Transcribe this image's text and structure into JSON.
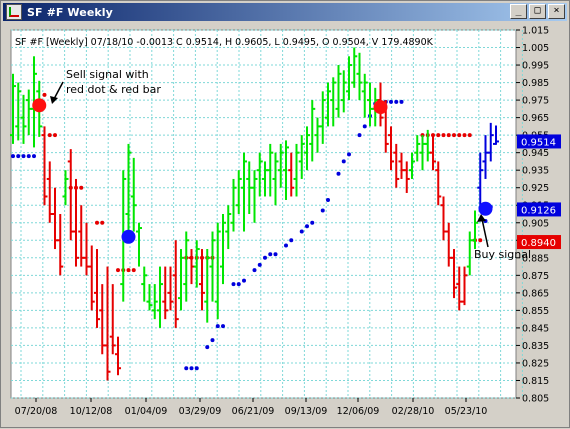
{
  "window": {
    "title": "SF #F Weekly",
    "buttons": {
      "minimize": "_",
      "maximize": "□",
      "close": "×"
    }
  },
  "info_line": "SF #F [Weekly] 07/18/10 -0.0013 C 0.9514, H 0.9605, L 0.9495, O 0.9504, V 179.4890K",
  "annotations": {
    "sell": [
      "Sell signal with",
      "red dot & red bar"
    ],
    "buy": "Buy signal"
  },
  "colors": {
    "up": "#00e600",
    "down": "#e60000",
    "stop_blue": "#0000dd",
    "stop_red": "#e60000",
    "grid": "#7fd8d8",
    "plot_bg": "#ffffff"
  },
  "chart_data": {
    "type": "bar",
    "subtype": "ohlc-weekly",
    "y_range": [
      0.805,
      1.015
    ],
    "yticks": [
      "1.015",
      "1.005",
      "0.995",
      "0.985",
      "0.975",
      "0.965",
      "0.955",
      "0.945",
      "0.935",
      "0.925",
      "0.915",
      "0.905",
      "0.895",
      "0.885",
      "0.875",
      "0.865",
      "0.855",
      "0.845",
      "0.835",
      "0.825",
      "0.815",
      "0.805"
    ],
    "xticks": [
      "07/20/08",
      "10/12/08",
      "01/04/09",
      "03/29/09",
      "06/21/09",
      "09/13/09",
      "12/06/09",
      "02/28/10",
      "05/23/10"
    ],
    "price_labels": [
      {
        "text": "0.9514",
        "value": 0.9514,
        "color": "#0000dd"
      },
      {
        "text": "0.9126",
        "value": 0.9126,
        "color": "#0000dd"
      },
      {
        "text": "0.8940",
        "value": 0.894,
        "color": "#e60000"
      }
    ],
    "bars": [
      {
        "o": 0.955,
        "h": 0.99,
        "l": 0.95,
        "c": 0.983,
        "col": "up"
      },
      {
        "o": 0.96,
        "h": 0.985,
        "l": 0.952,
        "c": 0.98,
        "col": "up"
      },
      {
        "o": 0.965,
        "h": 0.978,
        "l": 0.95,
        "c": 0.96,
        "col": "up"
      },
      {
        "o": 0.975,
        "h": 0.981,
        "l": 0.955,
        "c": 0.97,
        "col": "up"
      },
      {
        "o": 0.97,
        "h": 1.0,
        "l": 0.948,
        "c": 0.99,
        "col": "up"
      },
      {
        "o": 0.98,
        "h": 0.986,
        "l": 0.954,
        "c": 0.96,
        "col": "up"
      },
      {
        "o": 0.955,
        "h": 0.96,
        "l": 0.915,
        "c": 0.92,
        "col": "down"
      },
      {
        "o": 0.93,
        "h": 0.94,
        "l": 0.905,
        "c": 0.91,
        "col": "down"
      },
      {
        "o": 0.91,
        "h": 0.925,
        "l": 0.89,
        "c": 0.895,
        "col": "down"
      },
      {
        "o": 0.895,
        "h": 0.91,
        "l": 0.875,
        "c": 0.88,
        "col": "down"
      },
      {
        "o": 0.92,
        "h": 0.935,
        "l": 0.915,
        "c": 0.93,
        "col": "up"
      },
      {
        "o": 0.94,
        "h": 0.947,
        "l": 0.895,
        "c": 0.9,
        "col": "down"
      },
      {
        "o": 0.9,
        "h": 0.93,
        "l": 0.88,
        "c": 0.885,
        "col": "down"
      },
      {
        "o": 0.9,
        "h": 0.915,
        "l": 0.88,
        "c": 0.885,
        "col": "down"
      },
      {
        "o": 0.885,
        "h": 0.905,
        "l": 0.875,
        "c": 0.88,
        "col": "down"
      },
      {
        "o": 0.88,
        "h": 0.892,
        "l": 0.855,
        "c": 0.86,
        "col": "down"
      },
      {
        "o": 0.865,
        "h": 0.89,
        "l": 0.845,
        "c": 0.85,
        "col": "down"
      },
      {
        "o": 0.855,
        "h": 0.87,
        "l": 0.83,
        "c": 0.835,
        "col": "down"
      },
      {
        "o": 0.835,
        "h": 0.88,
        "l": 0.815,
        "c": 0.82,
        "col": "down"
      },
      {
        "o": 0.84,
        "h": 0.87,
        "l": 0.83,
        "c": 0.835,
        "col": "down"
      },
      {
        "o": 0.83,
        "h": 0.84,
        "l": 0.818,
        "c": 0.822,
        "col": "down"
      },
      {
        "o": 0.87,
        "h": 0.935,
        "l": 0.86,
        "c": 0.93,
        "col": "up"
      },
      {
        "o": 0.91,
        "h": 0.95,
        "l": 0.9,
        "c": 0.945,
        "col": "up"
      },
      {
        "o": 0.92,
        "h": 0.942,
        "l": 0.9,
        "c": 0.915,
        "col": "up"
      },
      {
        "o": 0.9,
        "h": 0.905,
        "l": 0.88,
        "c": 0.902,
        "col": "up"
      },
      {
        "o": 0.87,
        "h": 0.88,
        "l": 0.86,
        "c": 0.875,
        "col": "up"
      },
      {
        "o": 0.86,
        "h": 0.87,
        "l": 0.855,
        "c": 0.858,
        "col": "up"
      },
      {
        "o": 0.855,
        "h": 0.87,
        "l": 0.85,
        "c": 0.86,
        "col": "up"
      },
      {
        "o": 0.855,
        "h": 0.88,
        "l": 0.845,
        "c": 0.87,
        "col": "up"
      },
      {
        "o": 0.86,
        "h": 0.88,
        "l": 0.85,
        "c": 0.855,
        "col": "down"
      },
      {
        "o": 0.865,
        "h": 0.88,
        "l": 0.855,
        "c": 0.86,
        "col": "down"
      },
      {
        "o": 0.875,
        "h": 0.895,
        "l": 0.845,
        "c": 0.85,
        "col": "down"
      },
      {
        "o": 0.862,
        "h": 0.89,
        "l": 0.855,
        "c": 0.885,
        "col": "up"
      },
      {
        "o": 0.87,
        "h": 0.9,
        "l": 0.86,
        "c": 0.895,
        "col": "up"
      },
      {
        "o": 0.885,
        "h": 0.89,
        "l": 0.87,
        "c": 0.88,
        "col": "down"
      },
      {
        "o": 0.88,
        "h": 0.895,
        "l": 0.868,
        "c": 0.89,
        "col": "up"
      },
      {
        "o": 0.87,
        "h": 0.89,
        "l": 0.855,
        "c": 0.865,
        "col": "down"
      },
      {
        "o": 0.86,
        "h": 0.89,
        "l": 0.848,
        "c": 0.885,
        "col": "up"
      },
      {
        "o": 0.88,
        "h": 0.9,
        "l": 0.86,
        "c": 0.895,
        "col": "up"
      },
      {
        "o": 0.86,
        "h": 0.905,
        "l": 0.85,
        "c": 0.9,
        "col": "up"
      },
      {
        "o": 0.88,
        "h": 0.91,
        "l": 0.87,
        "c": 0.905,
        "col": "up"
      },
      {
        "o": 0.9,
        "h": 0.915,
        "l": 0.89,
        "c": 0.91,
        "col": "up"
      },
      {
        "o": 0.905,
        "h": 0.93,
        "l": 0.9,
        "c": 0.925,
        "col": "up"
      },
      {
        "o": 0.915,
        "h": 0.935,
        "l": 0.91,
        "c": 0.93,
        "col": "up"
      },
      {
        "o": 0.925,
        "h": 0.945,
        "l": 0.9,
        "c": 0.94,
        "col": "up"
      },
      {
        "o": 0.93,
        "h": 0.94,
        "l": 0.91,
        "c": 0.925,
        "col": "up"
      },
      {
        "o": 0.925,
        "h": 0.935,
        "l": 0.905,
        "c": 0.93,
        "col": "up"
      },
      {
        "o": 0.935,
        "h": 0.945,
        "l": 0.92,
        "c": 0.94,
        "col": "up"
      },
      {
        "o": 0.93,
        "h": 0.94,
        "l": 0.92,
        "c": 0.935,
        "col": "up"
      },
      {
        "o": 0.935,
        "h": 0.95,
        "l": 0.92,
        "c": 0.945,
        "col": "up"
      },
      {
        "o": 0.93,
        "h": 0.945,
        "l": 0.915,
        "c": 0.94,
        "col": "up"
      },
      {
        "o": 0.935,
        "h": 0.95,
        "l": 0.925,
        "c": 0.945,
        "col": "up"
      },
      {
        "o": 0.935,
        "h": 0.952,
        "l": 0.918,
        "c": 0.948,
        "col": "up"
      },
      {
        "o": 0.935,
        "h": 0.945,
        "l": 0.92,
        "c": 0.925,
        "col": "down"
      },
      {
        "o": 0.93,
        "h": 0.95,
        "l": 0.92,
        "c": 0.945,
        "col": "up"
      },
      {
        "o": 0.94,
        "h": 0.955,
        "l": 0.93,
        "c": 0.95,
        "col": "up"
      },
      {
        "o": 0.945,
        "h": 0.96,
        "l": 0.935,
        "c": 0.955,
        "col": "up"
      },
      {
        "o": 0.95,
        "h": 0.975,
        "l": 0.94,
        "c": 0.97,
        "col": "up"
      },
      {
        "o": 0.955,
        "h": 0.965,
        "l": 0.945,
        "c": 0.96,
        "col": "up"
      },
      {
        "o": 0.96,
        "h": 0.98,
        "l": 0.95,
        "c": 0.975,
        "col": "up"
      },
      {
        "o": 0.965,
        "h": 0.985,
        "l": 0.96,
        "c": 0.98,
        "col": "up"
      },
      {
        "o": 0.975,
        "h": 0.988,
        "l": 0.96,
        "c": 0.985,
        "col": "up"
      },
      {
        "o": 0.97,
        "h": 0.995,
        "l": 0.965,
        "c": 0.99,
        "col": "up"
      },
      {
        "o": 0.975,
        "h": 0.992,
        "l": 0.968,
        "c": 0.985,
        "col": "up"
      },
      {
        "o": 0.98,
        "h": 1.0,
        "l": 0.975,
        "c": 0.995,
        "col": "up"
      },
      {
        "o": 0.985,
        "h": 1.005,
        "l": 0.982,
        "c": 1.0,
        "col": "up"
      },
      {
        "o": 0.99,
        "h": 1.002,
        "l": 0.975,
        "c": 0.985,
        "col": "up"
      },
      {
        "o": 0.98,
        "h": 0.99,
        "l": 0.965,
        "c": 0.985,
        "col": "up"
      },
      {
        "o": 0.975,
        "h": 0.985,
        "l": 0.96,
        "c": 0.97,
        "col": "up"
      },
      {
        "o": 0.97,
        "h": 0.982,
        "l": 0.96,
        "c": 0.975,
        "col": "up"
      },
      {
        "o": 0.975,
        "h": 0.985,
        "l": 0.96,
        "c": 0.965,
        "col": "down"
      },
      {
        "o": 0.97,
        "h": 0.975,
        "l": 0.945,
        "c": 0.95,
        "col": "down"
      },
      {
        "o": 0.955,
        "h": 0.96,
        "l": 0.935,
        "c": 0.94,
        "col": "down"
      },
      {
        "o": 0.945,
        "h": 0.95,
        "l": 0.925,
        "c": 0.93,
        "col": "down"
      },
      {
        "o": 0.94,
        "h": 0.945,
        "l": 0.93,
        "c": 0.935,
        "col": "down"
      },
      {
        "o": 0.935,
        "h": 0.94,
        "l": 0.922,
        "c": 0.93,
        "col": "down"
      },
      {
        "o": 0.935,
        "h": 0.945,
        "l": 0.93,
        "c": 0.94,
        "col": "up"
      },
      {
        "o": 0.945,
        "h": 0.955,
        "l": 0.94,
        "c": 0.95,
        "col": "up"
      },
      {
        "o": 0.945,
        "h": 0.955,
        "l": 0.935,
        "c": 0.95,
        "col": "up"
      },
      {
        "o": 0.95,
        "h": 0.958,
        "l": 0.94,
        "c": 0.945,
        "col": "up"
      },
      {
        "o": 0.945,
        "h": 0.955,
        "l": 0.935,
        "c": 0.94,
        "col": "down"
      },
      {
        "o": 0.935,
        "h": 0.94,
        "l": 0.915,
        "c": 0.92,
        "col": "down"
      },
      {
        "o": 0.915,
        "h": 0.92,
        "l": 0.895,
        "c": 0.9,
        "col": "down"
      },
      {
        "o": 0.9,
        "h": 0.905,
        "l": 0.88,
        "c": 0.885,
        "col": "down"
      },
      {
        "o": 0.885,
        "h": 0.89,
        "l": 0.862,
        "c": 0.868,
        "col": "down"
      },
      {
        "o": 0.87,
        "h": 0.88,
        "l": 0.855,
        "c": 0.86,
        "col": "down"
      },
      {
        "o": 0.86,
        "h": 0.88,
        "l": 0.858,
        "c": 0.875,
        "col": "down"
      },
      {
        "o": 0.88,
        "h": 0.9,
        "l": 0.875,
        "c": 0.895,
        "col": "up"
      },
      {
        "o": 0.895,
        "h": 0.912,
        "l": 0.89,
        "c": 0.905,
        "col": "up"
      },
      {
        "o": 0.925,
        "h": 0.945,
        "l": 0.915,
        "c": 0.935,
        "col": "stop_blue"
      },
      {
        "o": 0.94,
        "h": 0.955,
        "l": 0.93,
        "c": 0.945,
        "col": "stop_blue"
      },
      {
        "o": 0.945,
        "h": 0.962,
        "l": 0.94,
        "c": 0.955,
        "col": "stop_blue"
      },
      {
        "o": 0.95,
        "h": 0.9605,
        "l": 0.9495,
        "c": 0.9514,
        "col": "stop_blue"
      }
    ],
    "blue_stops": [
      {
        "i": 0,
        "v": 0.943
      },
      {
        "i": 1,
        "v": 0.943
      },
      {
        "i": 2,
        "v": 0.943
      },
      {
        "i": 3,
        "v": 0.943
      },
      {
        "i": 4,
        "v": 0.943
      },
      {
        "i": 33,
        "v": 0.822
      },
      {
        "i": 34,
        "v": 0.822
      },
      {
        "i": 35,
        "v": 0.822
      },
      {
        "i": 37,
        "v": 0.834
      },
      {
        "i": 38,
        "v": 0.838
      },
      {
        "i": 39,
        "v": 0.846
      },
      {
        "i": 40,
        "v": 0.846
      },
      {
        "i": 42,
        "v": 0.87
      },
      {
        "i": 43,
        "v": 0.87
      },
      {
        "i": 44,
        "v": 0.872
      },
      {
        "i": 46,
        "v": 0.878
      },
      {
        "i": 47,
        "v": 0.881
      },
      {
        "i": 48,
        "v": 0.885
      },
      {
        "i": 49,
        "v": 0.887
      },
      {
        "i": 50,
        "v": 0.887
      },
      {
        "i": 52,
        "v": 0.892
      },
      {
        "i": 53,
        "v": 0.895
      },
      {
        "i": 55,
        "v": 0.9
      },
      {
        "i": 56,
        "v": 0.903
      },
      {
        "i": 57,
        "v": 0.905
      },
      {
        "i": 59,
        "v": 0.912
      },
      {
        "i": 60,
        "v": 0.918
      },
      {
        "i": 62,
        "v": 0.933
      },
      {
        "i": 63,
        "v": 0.94
      },
      {
        "i": 64,
        "v": 0.944
      },
      {
        "i": 66,
        "v": 0.955
      },
      {
        "i": 67,
        "v": 0.96
      },
      {
        "i": 68,
        "v": 0.966
      },
      {
        "i": 69,
        "v": 0.973
      },
      {
        "i": 70,
        "v": 0.974
      },
      {
        "i": 71,
        "v": 0.974
      },
      {
        "i": 72,
        "v": 0.974
      },
      {
        "i": 73,
        "v": 0.974
      },
      {
        "i": 74,
        "v": 0.974
      },
      {
        "i": 90,
        "v": 0.906
      },
      {
        "i": 91,
        "v": 0.914
      }
    ],
    "red_stops": [
      {
        "i": 6,
        "v": 0.978
      },
      {
        "i": 7,
        "v": 0.955
      },
      {
        "i": 8,
        "v": 0.955
      },
      {
        "i": 11,
        "v": 0.925
      },
      {
        "i": 12,
        "v": 0.925
      },
      {
        "i": 13,
        "v": 0.925
      },
      {
        "i": 16,
        "v": 0.905
      },
      {
        "i": 17,
        "v": 0.905
      },
      {
        "i": 20,
        "v": 0.878
      },
      {
        "i": 21,
        "v": 0.878
      },
      {
        "i": 22,
        "v": 0.878
      },
      {
        "i": 23,
        "v": 0.878
      },
      {
        "i": 33,
        "v": 0.885
      },
      {
        "i": 34,
        "v": 0.885
      },
      {
        "i": 35,
        "v": 0.885
      },
      {
        "i": 36,
        "v": 0.885
      },
      {
        "i": 37,
        "v": 0.885
      },
      {
        "i": 38,
        "v": 0.885
      },
      {
        "i": 78,
        "v": 0.955
      },
      {
        "i": 79,
        "v": 0.955
      },
      {
        "i": 80,
        "v": 0.955
      },
      {
        "i": 81,
        "v": 0.955
      },
      {
        "i": 82,
        "v": 0.955
      },
      {
        "i": 83,
        "v": 0.955
      },
      {
        "i": 84,
        "v": 0.955
      },
      {
        "i": 85,
        "v": 0.955
      },
      {
        "i": 86,
        "v": 0.955
      },
      {
        "i": 87,
        "v": 0.955
      },
      {
        "i": 88,
        "v": 0.895
      },
      {
        "i": 89,
        "v": 0.895
      }
    ],
    "signals": [
      {
        "kind": "sell",
        "i": 5,
        "v": 0.972,
        "color": "#ff1010"
      },
      {
        "kind": "sell",
        "i": 70,
        "v": 0.971,
        "color": "#ff1010"
      },
      {
        "kind": "buy",
        "i": 22,
        "v": 0.897,
        "color": "#1010ff"
      },
      {
        "kind": "buy",
        "i": 90,
        "v": 0.913,
        "color": "#1010ff"
      }
    ]
  }
}
